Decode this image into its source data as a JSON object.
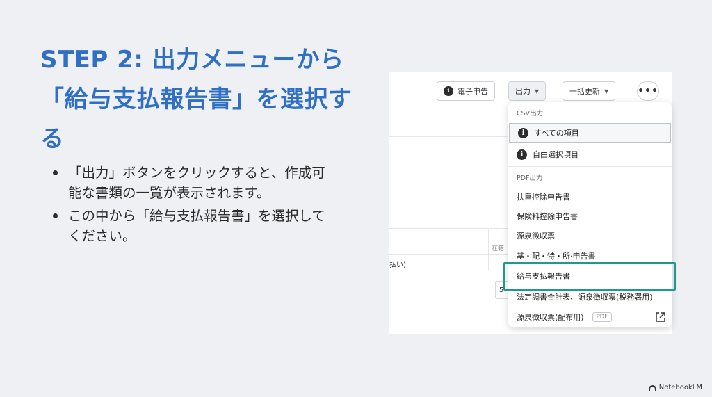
{
  "slide": {
    "title": "STEP 2: 出力メニューから「給与支払報告書」を選択する",
    "bullets": [
      "「出力」ボタンをクリックすると、作成可能な書類の一覧が表示されます。",
      "この中から「給与支払報告書」を選択してください。"
    ]
  },
  "toolbar": {
    "e_filing_label": "電子申告",
    "output_label": "出力",
    "bulk_update_label": "一括更新",
    "more_label": "•••"
  },
  "background": {
    "col_header_partial": "在籍",
    "row_text_partial": "払い)",
    "box_text_partial": "5"
  },
  "menu": {
    "csv_section": "CSV出力",
    "csv_items": [
      "すべての項目",
      "自由選択項目"
    ],
    "pdf_section": "PDF出力",
    "pdf_items": [
      "扶重控除申告書",
      "保険料控除申告書",
      "源泉徴収票",
      "基・配・特・所·申告書",
      "給与支払報告書",
      "法定調書合計表、源泉徴収票(税務署用)",
      "源泉徴収票(配布用)"
    ],
    "pdf_badge": "PDF",
    "highlight_color": "#1e9a8a"
  },
  "brand": {
    "name": "NotebookLM"
  },
  "colors": {
    "title": "#2f6fc6",
    "background": "#eef0f4"
  }
}
